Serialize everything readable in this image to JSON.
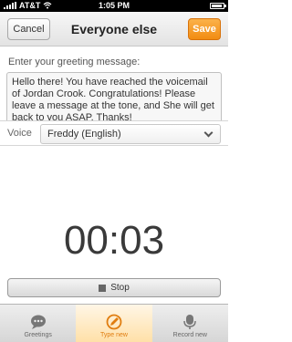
{
  "status_bar": {
    "carrier": "AT&T",
    "time": "1:05 PM",
    "battery_level": 0.9
  },
  "nav": {
    "title": "Everyone else",
    "cancel_label": "Cancel",
    "save_label": "Save"
  },
  "greeting": {
    "prompt": "Enter your greeting message:",
    "message": "Hello there! You have reached the voicemail of Jordan Crook. Congratulations! Please leave a message at the tone, and She will get back to you ASAP. Thanks!"
  },
  "voice": {
    "label": "Voice",
    "value": "Freddy (English)"
  },
  "timer": "00:03",
  "stop_label": "Stop",
  "tabs": [
    {
      "label": "Greetings",
      "icon": "speech-bubble-icon"
    },
    {
      "label": "Type new",
      "icon": "pencil-icon"
    },
    {
      "label": "Record new",
      "icon": "microphone-icon"
    }
  ],
  "colors": {
    "accent": "#f28c12",
    "active_tab": "#e07d10"
  }
}
